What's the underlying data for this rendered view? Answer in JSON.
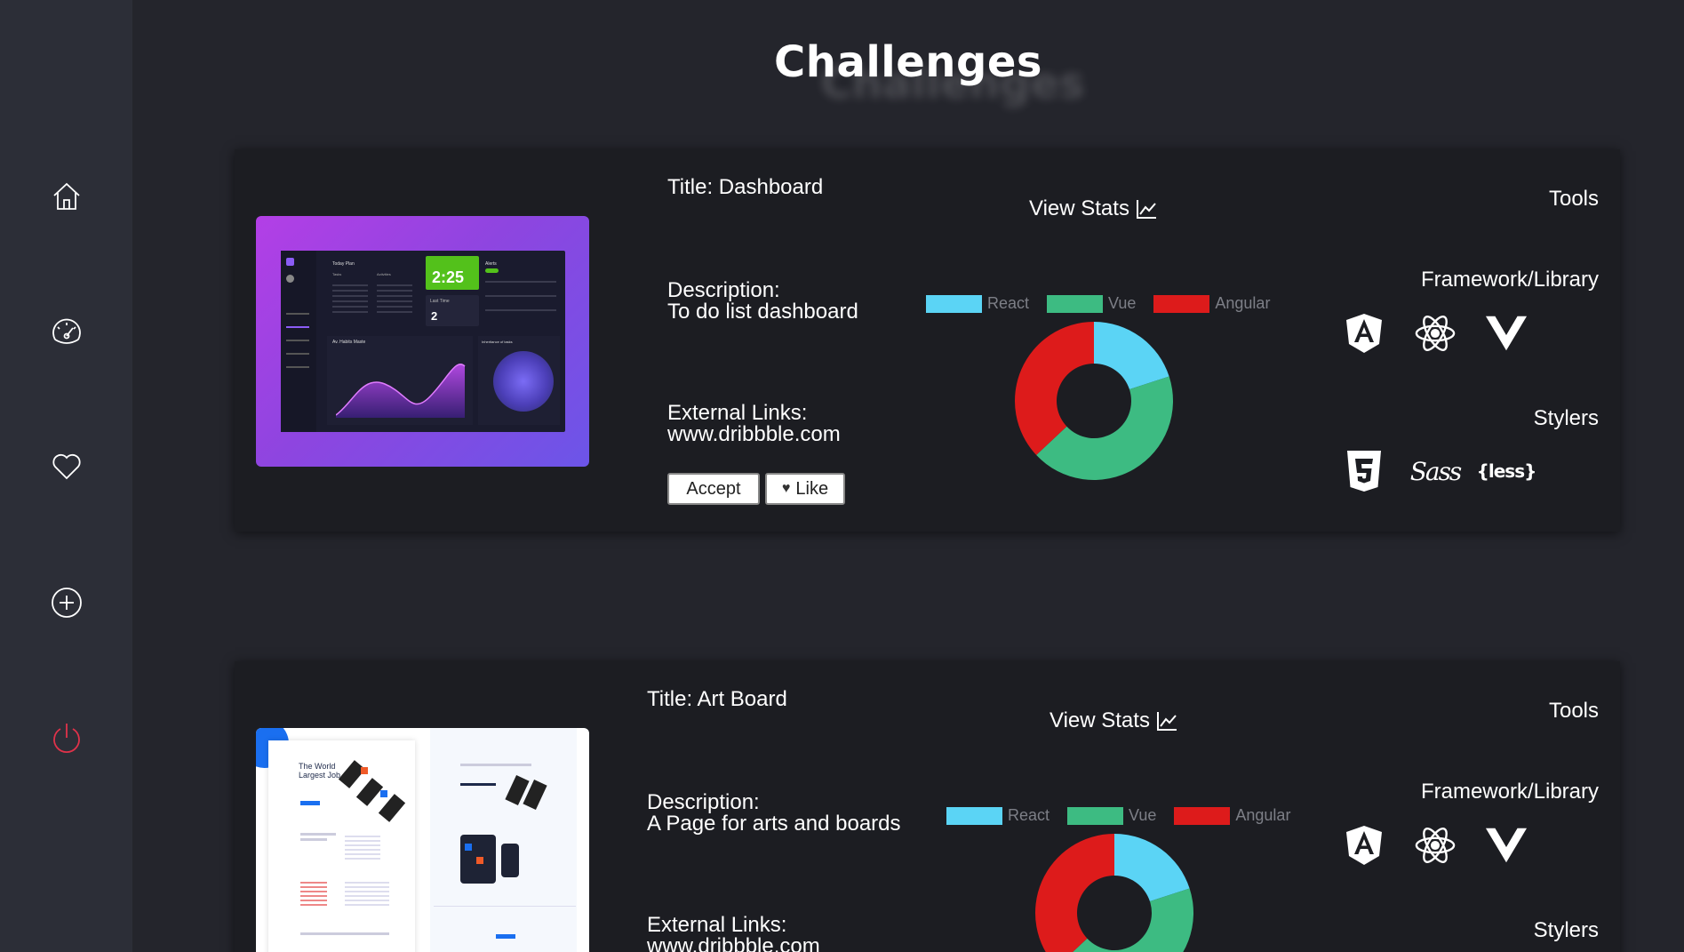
{
  "page": {
    "title": "Challenges"
  },
  "colors": {
    "react": "#5bd4f5",
    "vue": "#3dbb82",
    "angular": "#dd1b1b",
    "power": "#e0324a"
  },
  "sidebar": {
    "items": [
      {
        "name": "home-icon"
      },
      {
        "name": "dashboard-gauge-icon"
      },
      {
        "name": "heart-icon"
      },
      {
        "name": "plus-circle-icon"
      },
      {
        "name": "power-icon"
      }
    ]
  },
  "cards": [
    {
      "title": "Title: Dashboard",
      "description_label": "Description:",
      "description": "To do list dashboard",
      "links_label": "External Links:",
      "link": "www.dribbble.com",
      "view_stats": "View Stats",
      "accept": "Accept",
      "like": "Like",
      "tools_label": "Tools",
      "framework_label": "Framework/Library",
      "stylers_label": "Stylers",
      "thumb": {
        "today_plan": "Today Plan",
        "tasks": "Tasks",
        "activities": "Activities",
        "timer": "2:25",
        "last_time": "Last Time",
        "last_value": "2",
        "chart_title": "Av. Habits Maste",
        "side_title": "Inheritance of tasks",
        "alerts": "Alerts"
      }
    },
    {
      "title": "Title: Art Board",
      "description_label": "Description:",
      "description": "A Page for arts and boards",
      "links_label": "External Links:",
      "link": "www.dribbble.com",
      "view_stats": "View Stats",
      "tools_label": "Tools",
      "framework_label": "Framework/Library",
      "stylers_label": "Stylers",
      "thumb": {
        "headline": "The World Largest Job App"
      }
    }
  ],
  "chart_data": [
    {
      "type": "pie",
      "categories": [
        "React",
        "Vue",
        "Angular"
      ],
      "values": [
        20,
        43,
        37
      ]
    },
    {
      "type": "pie",
      "categories": [
        "React",
        "Vue",
        "Angular"
      ],
      "values": [
        20,
        43,
        37
      ]
    }
  ]
}
